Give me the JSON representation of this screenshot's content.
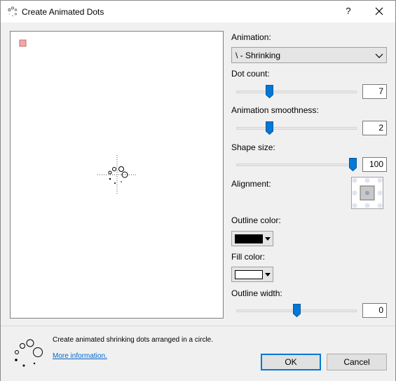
{
  "window": {
    "title": "Create Animated Dots",
    "help_label": "?"
  },
  "animation": {
    "label": "Animation:",
    "selected": "\\ - Shrinking"
  },
  "dot_count": {
    "label": "Dot count:",
    "value": "7",
    "fraction": 0.26
  },
  "smoothness": {
    "label": "Animation smoothness:",
    "value": "2",
    "fraction": 0.26
  },
  "shape_size": {
    "label": "Shape size:",
    "value": "100",
    "fraction": 1.0
  },
  "alignment": {
    "label": "Alignment:",
    "selected": "center"
  },
  "outline_color": {
    "label": "Outline color:",
    "color": "#000000"
  },
  "fill_color": {
    "label": "Fill color:",
    "color": "#ffffff"
  },
  "outline_width": {
    "label": "Outline width:",
    "value": "0",
    "fraction": 0.5
  },
  "footer": {
    "description": "Create animated shrinking dots arranged in a circle.",
    "more_info": "More information."
  },
  "buttons": {
    "ok": "OK",
    "cancel": "Cancel"
  },
  "colors": {
    "accent": "#0078d7",
    "preview_marker": "#f4a6a6"
  }
}
